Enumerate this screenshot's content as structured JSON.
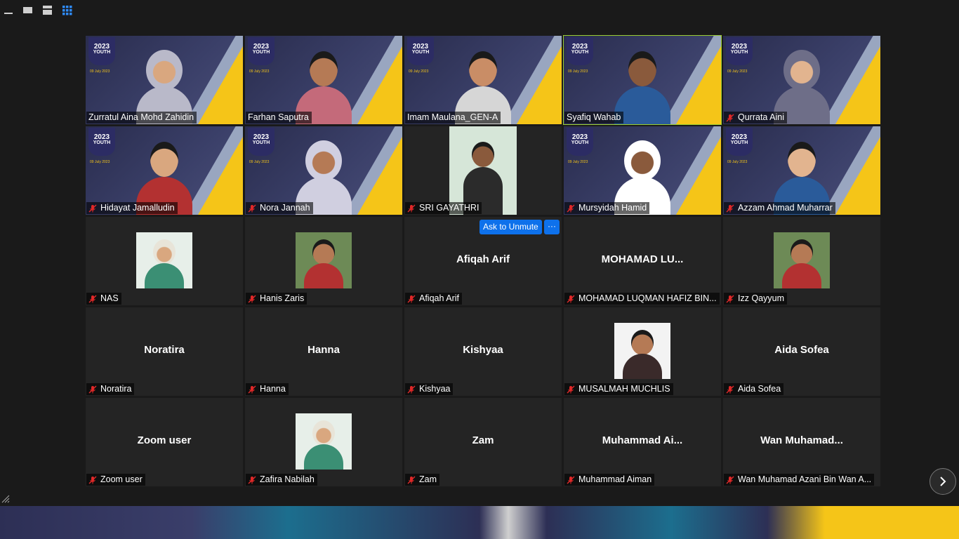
{
  "view_modes": [
    {
      "name": "minimize-icon"
    },
    {
      "name": "speaker-view-icon"
    },
    {
      "name": "strip-view-icon"
    },
    {
      "name": "gallery-view-icon",
      "active": true
    }
  ],
  "event": {
    "logo_line1": "2023",
    "logo_line2": "YOUTH",
    "date": "09 July 2023"
  },
  "participants": [
    {
      "name": "Zurratul Aina Mohd Zahidin",
      "muted": false,
      "type": "video",
      "variant": "hijab"
    },
    {
      "name": "Farhan Saputra",
      "muted": false,
      "type": "video",
      "variant": "man"
    },
    {
      "name": "Imam Maulana_GEN-A",
      "muted": false,
      "type": "video",
      "variant": "man"
    },
    {
      "name": "Syafiq Wahab",
      "muted": false,
      "type": "video",
      "variant": "man",
      "active_speaker": true
    },
    {
      "name": "Qurrata Aini",
      "muted": true,
      "type": "video",
      "variant": "hijab"
    },
    {
      "name": "Hidayat Jamalludin",
      "muted": true,
      "type": "video",
      "variant": "man"
    },
    {
      "name": "Nora Jannah",
      "muted": true,
      "type": "video",
      "variant": "hijab"
    },
    {
      "name": "SRI GAYATHRI",
      "muted": true,
      "type": "photo-video",
      "variant": "woman"
    },
    {
      "name": "Mursyidah Hamid",
      "muted": true,
      "type": "video",
      "variant": "hijab"
    },
    {
      "name": "Azzam Ahmad Muharrar",
      "muted": true,
      "type": "video",
      "variant": "man"
    },
    {
      "name": "NAS",
      "muted": true,
      "type": "avatar",
      "variant": "hijab"
    },
    {
      "name": "Hanis Zaris",
      "muted": true,
      "type": "avatar",
      "variant": "man"
    },
    {
      "name": "Afiqah Arif",
      "muted": true,
      "type": "name",
      "display": "Afiqah Arif"
    },
    {
      "name": "MOHAMAD LUQMAN HAFIZ BIN...",
      "muted": true,
      "type": "name",
      "display": "MOHAMAD  LU..."
    },
    {
      "name": "Izz Qayyum",
      "muted": true,
      "type": "avatar",
      "variant": "man"
    },
    {
      "name": "Noratira",
      "muted": true,
      "type": "name",
      "display": "Noratira"
    },
    {
      "name": "Hanna",
      "muted": true,
      "type": "name",
      "display": "Hanna"
    },
    {
      "name": "Kishyaa",
      "muted": true,
      "type": "name",
      "display": "Kishyaa"
    },
    {
      "name": "MUSALMAH MUCHLIS",
      "muted": true,
      "type": "avatar",
      "variant": "woman"
    },
    {
      "name": "Aida Sofea",
      "muted": true,
      "type": "name",
      "display": "Aida Sofea"
    },
    {
      "name": "Zoom user",
      "muted": true,
      "type": "name",
      "display": "Zoom user"
    },
    {
      "name": "Zafira Nabilah",
      "muted": true,
      "type": "avatar",
      "variant": "hijab"
    },
    {
      "name": "Zam",
      "muted": true,
      "type": "name",
      "display": "Zam"
    },
    {
      "name": "Muhammad Aiman",
      "muted": true,
      "type": "name",
      "display": "Muhammad  Ai..."
    },
    {
      "name": "Wan Muhamad Azani Bin Wan A...",
      "muted": true,
      "type": "name",
      "display": "Wan  Muhamad..."
    }
  ],
  "ask_to_unmute": {
    "label": "Ask to Unmute",
    "more_label": "···"
  },
  "colors": {
    "active_border": "#9acd32",
    "accent_blue": "#0e71eb",
    "muted_red": "#e02828",
    "event_yellow": "#f5c518"
  }
}
